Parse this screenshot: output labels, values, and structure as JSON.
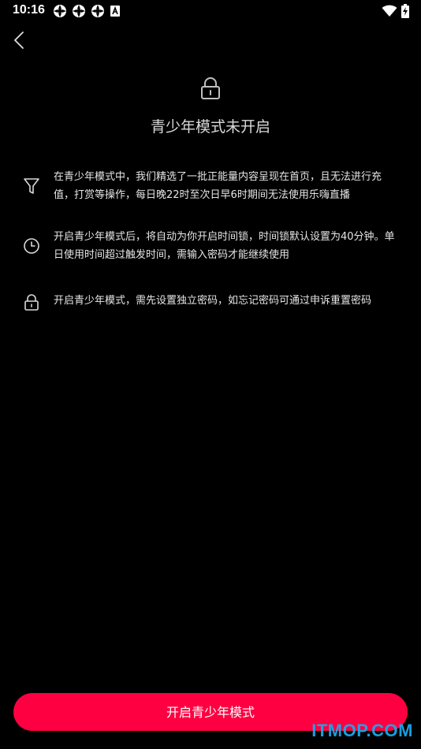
{
  "status_bar": {
    "time": "10:16",
    "notification_icons": [
      "app-notification-icon",
      "app-notification-icon",
      "app-notification-icon",
      "text-a-icon"
    ],
    "system_icons": [
      "wifi-icon",
      "battery-charging-icon"
    ]
  },
  "header": {
    "back_icon": "chevron-left-icon"
  },
  "hero": {
    "icon": "lock-icon",
    "title": "青少年模式未开启"
  },
  "features": [
    {
      "icon": "funnel-icon",
      "text": "在青少年模式中，我们精选了一批正能量内容呈现在首页，且无法进行充值，打赏等操作，每日晚22时至次日早6时期间无法使用乐嗨直播"
    },
    {
      "icon": "clock-icon",
      "text": "开启青少年模式后，将自动为你开启时间锁，时间锁默认设置为40分钟。单日使用时间超过触发时间，需输入密码才能继续使用"
    },
    {
      "icon": "lock-icon",
      "text": "开启青少年模式，需先设置独立密码，如忘记密码可通过申诉重置密码"
    }
  ],
  "actions": {
    "enable_label": "开启青少年模式"
  },
  "watermark": "ITMOP.COM",
  "colors": {
    "background": "#000000",
    "accent": "#fe0041",
    "text": "#e6e6e6",
    "watermark": "#1aa7e8"
  }
}
